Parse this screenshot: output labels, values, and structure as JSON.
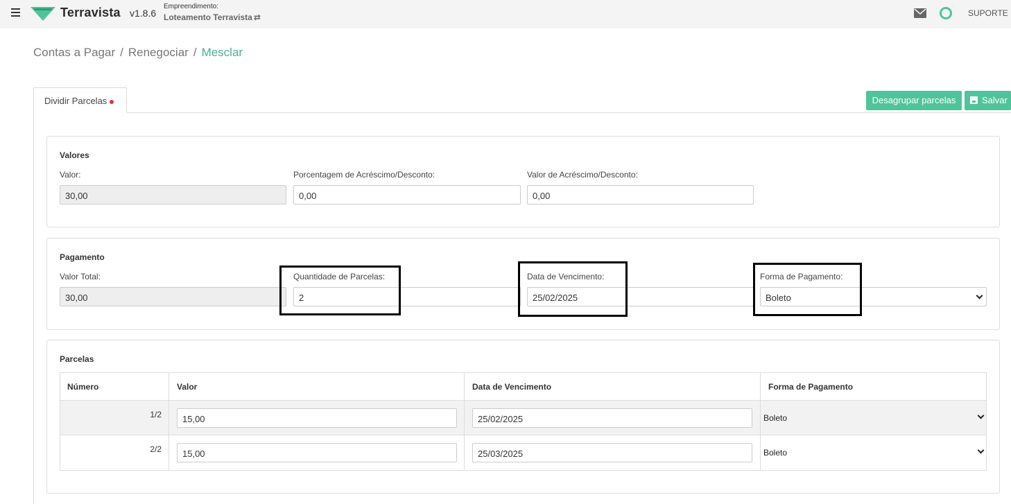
{
  "header": {
    "brand": "Terravista",
    "version": "v1.8.6",
    "project_label": "Empreendimento:",
    "project_name": "Loteamento Terravista",
    "support": "SUPORTE",
    "brand_color": "#4fc49b"
  },
  "breadcrumb": {
    "items": [
      "Contas a Pagar",
      "Renegociar",
      "Mesclar"
    ],
    "separator": "/"
  },
  "tabs": [
    {
      "label": "Dividir Parcelas",
      "active": true,
      "has_dot": true
    }
  ],
  "actions": {
    "ungroup_label": "Desagrupar parcelas",
    "save_label": "Salvar"
  },
  "valores": {
    "title": "Valores",
    "valor_label": "Valor:",
    "valor_value": "30,00",
    "percent_label": "Porcentagem de Acréscimo/Desconto:",
    "percent_value": "0,00",
    "amount_label": "Valor de Acréscimo/Desconto:",
    "amount_value": "0,00"
  },
  "pagamento": {
    "title": "Pagamento",
    "total_label": "Valor Total:",
    "total_value": "30,00",
    "qty_label": "Quantidade de Parcelas:",
    "qty_value": "2",
    "due_label": "Data de Vencimento:",
    "due_value": "25/02/2025",
    "method_label": "Forma de Pagamento:",
    "method_value": "Boleto"
  },
  "parcelas": {
    "title": "Parcelas",
    "columns": [
      "Número",
      "Valor",
      "Data de Vencimento",
      "Forma de Pagamento"
    ],
    "rows": [
      {
        "numero": "1/2",
        "valor": "15,00",
        "vencimento": "25/02/2025",
        "forma": "Boleto"
      },
      {
        "numero": "2/2",
        "valor": "15,00",
        "vencimento": "25/03/2025",
        "forma": "Boleto"
      }
    ]
  }
}
